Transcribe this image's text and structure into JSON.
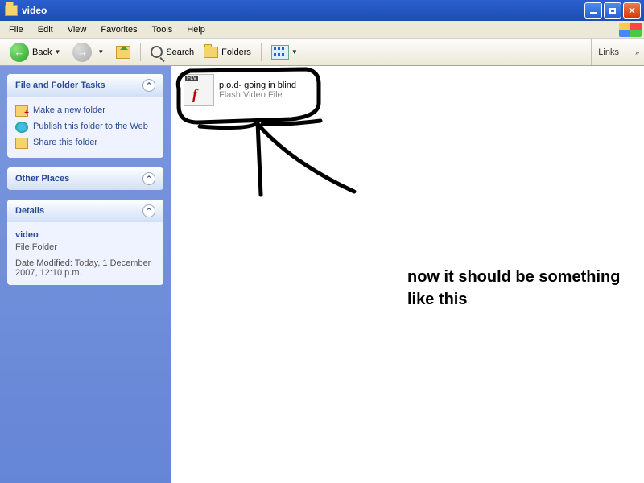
{
  "window": {
    "title": "video"
  },
  "menu": {
    "file": "File",
    "edit": "Edit",
    "view": "View",
    "favorites": "Favorites",
    "tools": "Tools",
    "help": "Help"
  },
  "toolbar": {
    "back": "Back",
    "search": "Search",
    "folders": "Folders",
    "links": "Links"
  },
  "sidebar": {
    "tasks": {
      "heading": "File and Folder Tasks",
      "new_folder": "Make a new folder",
      "publish": "Publish this folder to the Web",
      "share": "Share this folder"
    },
    "other_places": {
      "heading": "Other Places"
    },
    "details": {
      "heading": "Details",
      "folder_name": "video",
      "folder_type": "File Folder",
      "modified_label": "Date Modified: Today, 1 December 2007, 12:10 p.m."
    }
  },
  "file": {
    "name": "p.o.d- going in blind",
    "type": "Flash Video File"
  },
  "annotation": {
    "line1": "now it should be something",
    "line2": "like this"
  }
}
